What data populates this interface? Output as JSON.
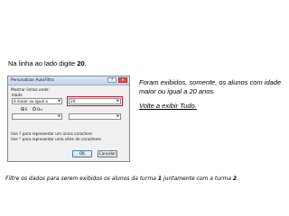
{
  "slide": {
    "instruction_prefix": "Na linha ao lado digite ",
    "instruction_value": "20",
    "instruction_suffix": ".",
    "note_line": "Foram exibidos, somente, os alunos com idade maior ou igual a 20 anos.",
    "note_link": "Volte a exibir Tudo",
    "note_link_suffix": ".",
    "bottom_prefix": "Filtre os dados para serem exibidos os alunos da turma ",
    "bottom_turma1": "1",
    "bottom_middle": " juntamente com a turma ",
    "bottom_turma2": "2",
    "bottom_suffix": "."
  },
  "dialog": {
    "title": "Personalizar AutoFiltro",
    "help_label": "?",
    "close_label": "✕",
    "section_label": "Mostrar linhas onde:",
    "field_label": "Idade",
    "condition1": {
      "operator": "é maior ou igual a",
      "value": "20"
    },
    "logic": {
      "and_label": "E",
      "or_label": "Ou",
      "selected": "E"
    },
    "condition2": {
      "operator": "",
      "value": ""
    },
    "hint1": "Use ? para representar um único caractere",
    "hint2": "Use * para representar uma série de caracteres",
    "ok_label": "OK",
    "cancel_label": "Cancelar"
  },
  "colors": {
    "highlight": "#c8102e"
  }
}
